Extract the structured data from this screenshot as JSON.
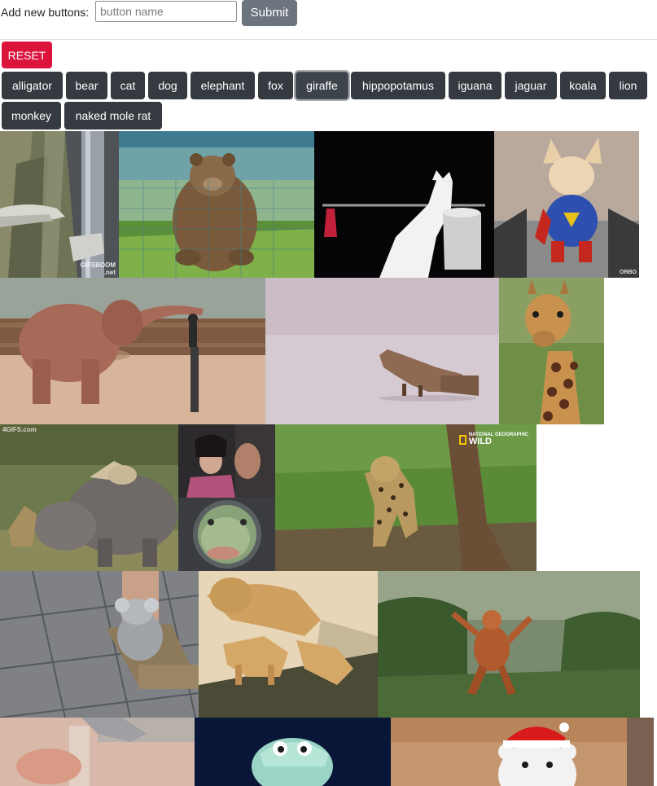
{
  "form": {
    "label": "Add new buttons:",
    "input_placeholder": "button name",
    "input_value": "",
    "submit_label": "Submit"
  },
  "reset_label": "RESET",
  "animal_buttons": [
    {
      "label": "alligator",
      "active": false
    },
    {
      "label": "bear",
      "active": false
    },
    {
      "label": "cat",
      "active": false
    },
    {
      "label": "dog",
      "active": false
    },
    {
      "label": "elephant",
      "active": false
    },
    {
      "label": "fox",
      "active": false
    },
    {
      "label": "giraffe",
      "active": true
    },
    {
      "label": "hippopotamus",
      "active": false
    },
    {
      "label": "iguana",
      "active": false
    },
    {
      "label": "jaguar",
      "active": false
    },
    {
      "label": "koala",
      "active": false
    },
    {
      "label": "lion",
      "active": false
    },
    {
      "label": "monkey",
      "active": false
    },
    {
      "label": "naked mole rat",
      "active": false
    }
  ],
  "gallery": {
    "alligator_watermark": [
      "GIFSBOOM",
      ".net"
    ],
    "dog_watermark": "ORBO",
    "hippo_watermark": "4GIFS.com",
    "jaguar_watermark_small": "NATIONAL GEOGRAPHIC",
    "jaguar_watermark_big": "WILD"
  },
  "colors": {
    "submit": "#6c757d",
    "reset": "#dc143c",
    "dark_button": "#343a40"
  }
}
